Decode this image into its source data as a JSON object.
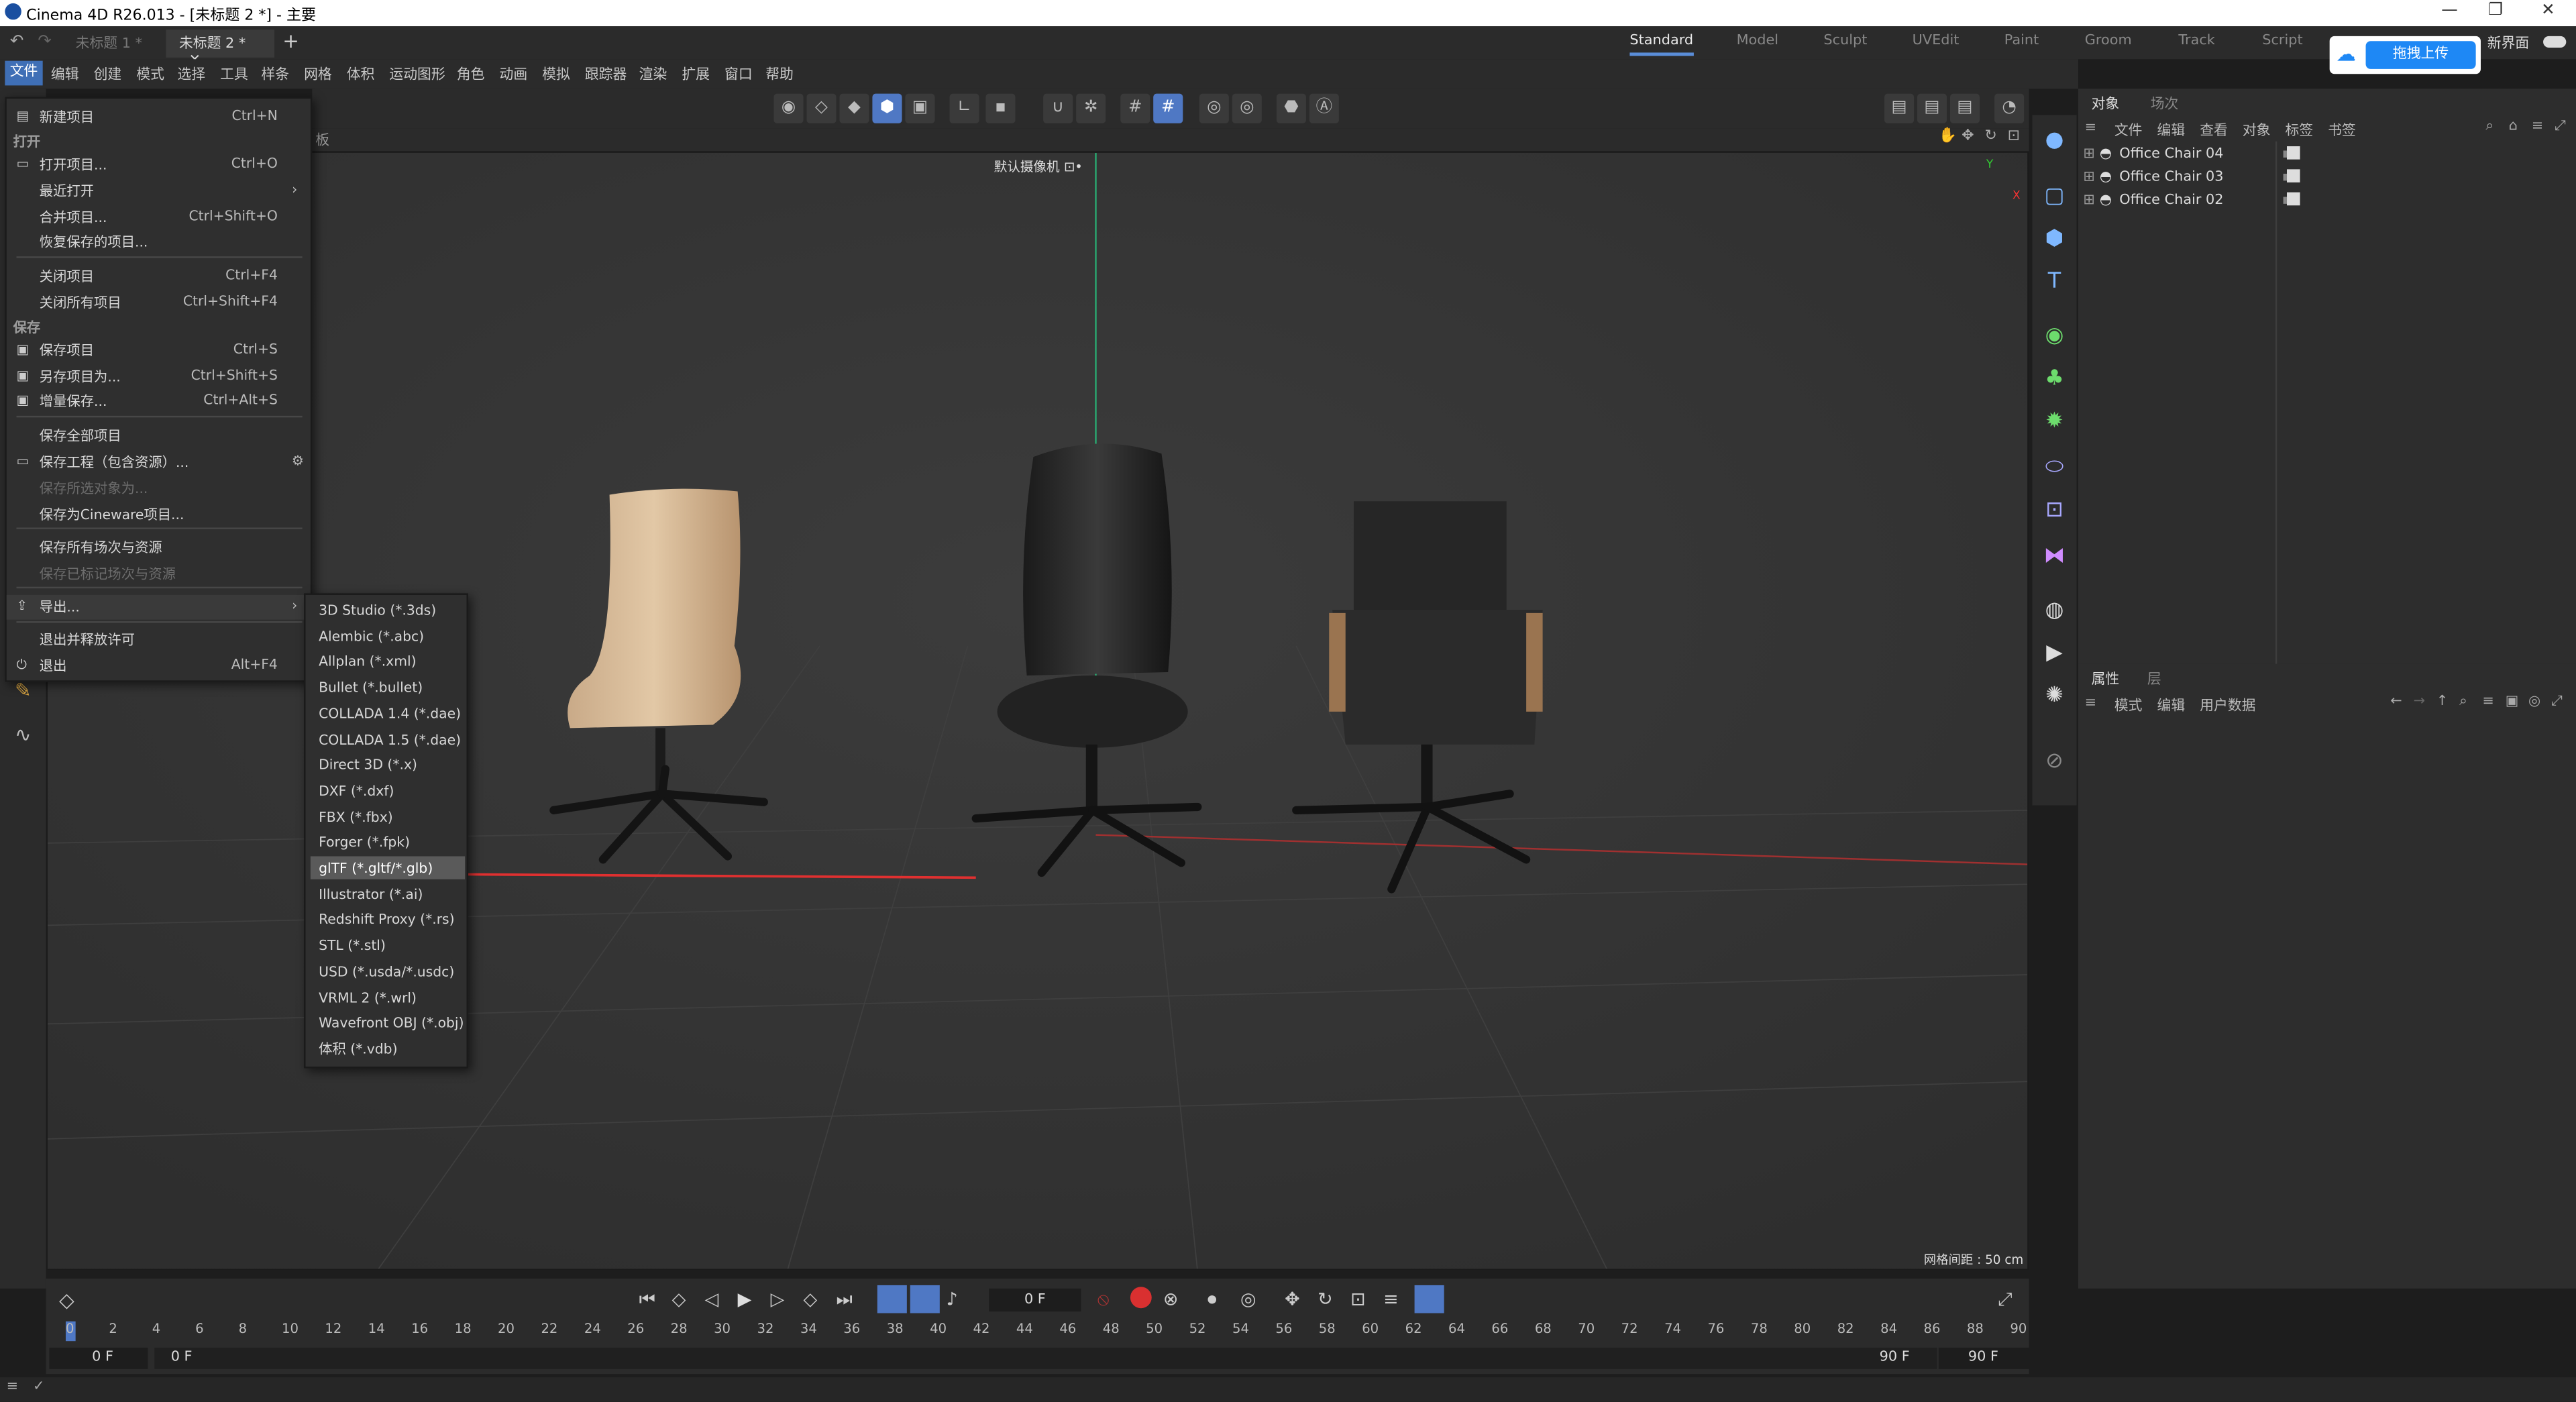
{
  "window": {
    "title": "Cinema 4D R26.013 - [未标题 2 *] - 主要",
    "min": "—",
    "max": "❐",
    "close": "✕"
  },
  "tabs": [
    {
      "label": "未标题 1 *"
    },
    {
      "label": "未标题 2 *",
      "close": "✕"
    }
  ],
  "new_tab": "+",
  "layouts": [
    "Standard",
    "Model",
    "Sculpt",
    "UVEdit",
    "Paint",
    "Groom",
    "Track",
    "Script"
  ],
  "upload_button": "拖拽上传",
  "new_layout": "新界面",
  "menubar": [
    "文件",
    "编辑",
    "创建",
    "模式",
    "选择",
    "工具",
    "样条",
    "网格",
    "体积",
    "运动图形",
    "角色",
    "动画",
    "模拟",
    "跟踪器",
    "渲染",
    "扩展",
    "窗口",
    "帮助"
  ],
  "viewport": {
    "panel_label": "板",
    "camera": "默认摄像机 ⊡•",
    "grid_spacing": "网格间距 : 50 cm",
    "axis_y": "Y",
    "axis_x": "X"
  },
  "file_menu": [
    {
      "label": "新建项目",
      "shortcut": "Ctrl+N",
      "icon": "new-doc"
    },
    {
      "label": "打开",
      "header": true
    },
    {
      "label": "打开项目...",
      "shortcut": "Ctrl+O",
      "icon": "folder"
    },
    {
      "label": "最近打开",
      "arrow": "›"
    },
    {
      "label": "合并项目...",
      "shortcut": "Ctrl+Shift+O"
    },
    {
      "label": "恢复保存的项目..."
    },
    {
      "label": "关闭项目",
      "shortcut": "Ctrl+F4"
    },
    {
      "label": "关闭所有项目",
      "shortcut": "Ctrl+Shift+F4"
    },
    {
      "label": "保存",
      "header": true
    },
    {
      "label": "保存项目",
      "shortcut": "Ctrl+S",
      "icon": "save"
    },
    {
      "label": "另存项目为...",
      "shortcut": "Ctrl+Shift+S",
      "icon": "save-as"
    },
    {
      "label": "增量保存...",
      "shortcut": "Ctrl+Alt+S",
      "icon": "save-inc"
    },
    {
      "label": "保存全部项目"
    },
    {
      "label": "保存工程（包含资源）...",
      "icon": "folder",
      "gear": "⚙"
    },
    {
      "label": "保存所选对象为...",
      "disabled": true
    },
    {
      "label": "保存为Cineware项目..."
    },
    {
      "label": "保存所有场次与资源"
    },
    {
      "label": "保存已标记场次与资源",
      "disabled": true
    },
    {
      "label": "导出...",
      "arrow": "›",
      "icon": "export",
      "highlighted": true
    },
    {
      "label": "退出并释放许可"
    },
    {
      "label": "退出",
      "shortcut": "Alt+F4",
      "icon": "power"
    }
  ],
  "export_submenu": [
    "3D Studio (*.3ds)",
    "Alembic (*.abc)",
    "Allplan (*.xml)",
    "Bullet (*.bullet)",
    "COLLADA 1.4 (*.dae)",
    "COLLADA 1.5 (*.dae)",
    "Direct 3D (*.x)",
    "DXF (*.dxf)",
    "FBX (*.fbx)",
    "Forger (*.fpk)",
    "glTF (*.gltf/*.glb)",
    "Illustrator (*.ai)",
    "Redshift Proxy (*.rs)",
    "STL (*.stl)",
    "USD (*.usda/*.usdc)",
    "VRML 2 (*.wrl)",
    "Wavefront OBJ (*.obj)",
    "体积 (*.vdb)"
  ],
  "export_highlighted": "glTF (*.gltf/*.glb)",
  "object_panel": {
    "tabs": [
      "对象",
      "场次"
    ],
    "menu": [
      "文件",
      "编辑",
      "查看",
      "对象",
      "标签",
      "书签"
    ],
    "objects": [
      "Office Chair 04",
      "Office Chair 03",
      "Office Chair 02"
    ]
  },
  "attr_panel": {
    "tabs": [
      "属性",
      "层"
    ],
    "menu": [
      "模式",
      "编辑",
      "用户数据"
    ]
  },
  "timeline": {
    "current_frame": "0 F",
    "start_field": "0 F",
    "start_field2": "0 F",
    "end_field": "90 F",
    "end_field2": "90 F",
    "ticks": [
      "0",
      "2",
      "4",
      "6",
      "8",
      "10",
      "12",
      "14",
      "16",
      "18",
      "20",
      "22",
      "24",
      "26",
      "28",
      "30",
      "32",
      "34",
      "36",
      "38",
      "40",
      "42",
      "44",
      "46",
      "48",
      "50",
      "52",
      "54",
      "56",
      "58",
      "60",
      "62",
      "64",
      "66",
      "68",
      "70",
      "72",
      "74",
      "76",
      "78",
      "80",
      "82",
      "84",
      "86",
      "88",
      "90"
    ]
  },
  "colors": {
    "accent": "#4f78c4",
    "menu_active": "#3f6fb6",
    "upload": "#1e88f5",
    "arrow": "#e03030"
  }
}
